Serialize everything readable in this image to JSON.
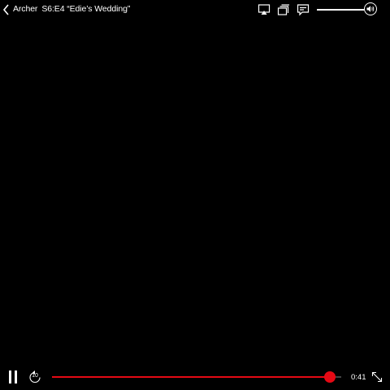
{
  "header": {
    "show_title": "Archer",
    "episode_title": "S6:E4 “Edie’s Wedding”"
  },
  "icons": {
    "back": "chevron-left-icon",
    "airplay": "airplay-icon",
    "episodes": "episodes-icon",
    "subtitles": "subtitles-icon",
    "volume": "volume-icon",
    "pause": "pause-icon",
    "rewind": "rewind-10-icon",
    "fullscreen": "fullscreen-icon"
  },
  "volume": {
    "level": 0.85
  },
  "playback": {
    "rewind_seconds": "10",
    "progress": 0.96,
    "time_remaining": "0:41"
  },
  "colors": {
    "background": "#000000",
    "accent": "#e50914",
    "foreground": "#ffffff"
  }
}
